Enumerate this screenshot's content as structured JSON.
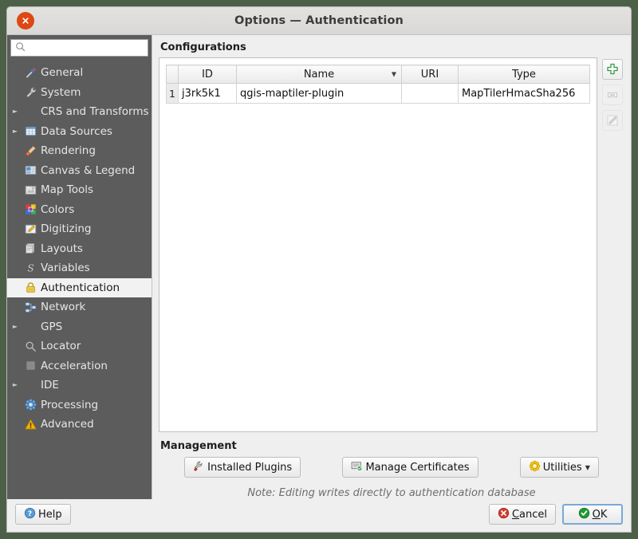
{
  "window": {
    "title": "Options — Authentication",
    "close_label": "Close"
  },
  "sidebar": {
    "search": {
      "value": "",
      "placeholder": ""
    },
    "items": [
      {
        "label": "General",
        "icon": "general-icon",
        "expandable": false,
        "selected": false
      },
      {
        "label": "System",
        "icon": "system-icon",
        "expandable": false,
        "selected": false
      },
      {
        "label": "CRS and Transforms",
        "icon": "none",
        "expandable": true,
        "selected": false
      },
      {
        "label": "Data Sources",
        "icon": "data-sources-icon",
        "expandable": true,
        "selected": false
      },
      {
        "label": "Rendering",
        "icon": "rendering-icon",
        "expandable": false,
        "selected": false
      },
      {
        "label": "Canvas & Legend",
        "icon": "canvas-legend-icon",
        "expandable": false,
        "selected": false
      },
      {
        "label": "Map Tools",
        "icon": "map-tools-icon",
        "expandable": false,
        "selected": false
      },
      {
        "label": "Colors",
        "icon": "colors-icon",
        "expandable": false,
        "selected": false
      },
      {
        "label": "Digitizing",
        "icon": "digitizing-icon",
        "expandable": false,
        "selected": false
      },
      {
        "label": "Layouts",
        "icon": "layouts-icon",
        "expandable": false,
        "selected": false
      },
      {
        "label": "Variables",
        "icon": "variables-icon",
        "expandable": false,
        "selected": false
      },
      {
        "label": "Authentication",
        "icon": "lock-icon",
        "expandable": false,
        "selected": true
      },
      {
        "label": "Network",
        "icon": "network-icon",
        "expandable": false,
        "selected": false
      },
      {
        "label": "GPS",
        "icon": "none",
        "expandable": true,
        "selected": false
      },
      {
        "label": "Locator",
        "icon": "search-icon",
        "expandable": false,
        "selected": false
      },
      {
        "label": "Acceleration",
        "icon": "acceleration-icon",
        "expandable": false,
        "selected": false
      },
      {
        "label": "IDE",
        "icon": "none",
        "expandable": true,
        "selected": false
      },
      {
        "label": "Processing",
        "icon": "processing-icon",
        "expandable": false,
        "selected": false
      },
      {
        "label": "Advanced",
        "icon": "warning-icon",
        "expandable": false,
        "selected": false
      }
    ]
  },
  "main": {
    "configurations_title": "Configurations",
    "table": {
      "columns": [
        "ID",
        "Name",
        "URI",
        "Type"
      ],
      "sorted_column": "Name",
      "sort_direction": "descending",
      "rows": [
        {
          "num": "1",
          "id": "j3rk5k1",
          "name": "qgis-maptiler-plugin",
          "uri": "",
          "type": "MapTilerHmacSha256"
        }
      ]
    },
    "tools": [
      {
        "name": "add-configuration-button",
        "icon": "plus-icon",
        "enabled": true
      },
      {
        "name": "remove-configuration-button",
        "icon": "minus-icon",
        "enabled": false
      },
      {
        "name": "edit-configuration-button",
        "icon": "pencil-icon",
        "enabled": false
      }
    ],
    "management_title": "Management",
    "management_buttons": [
      {
        "label": "Installed Plugins",
        "icon": "wrench-icon",
        "has_menu": false
      },
      {
        "label": "Manage Certificates",
        "icon": "certificate-icon",
        "has_menu": false
      },
      {
        "label": "Utilities",
        "icon": "gear-yellow-icon",
        "has_menu": true
      }
    ],
    "note": "Note: Editing writes directly to authentication database"
  },
  "footer": {
    "help_label": "Help",
    "cancel_label": "Cancel",
    "cancel_accel": "C",
    "ok_label": "OK",
    "ok_accel": "O"
  },
  "colors": {
    "sidebar_bg": "#5c5c5c",
    "accent_close": "#dd4814",
    "ok_green": "#1f9c35",
    "cancel_red": "#d33c2f",
    "desktop_bg": "#4c6048"
  }
}
